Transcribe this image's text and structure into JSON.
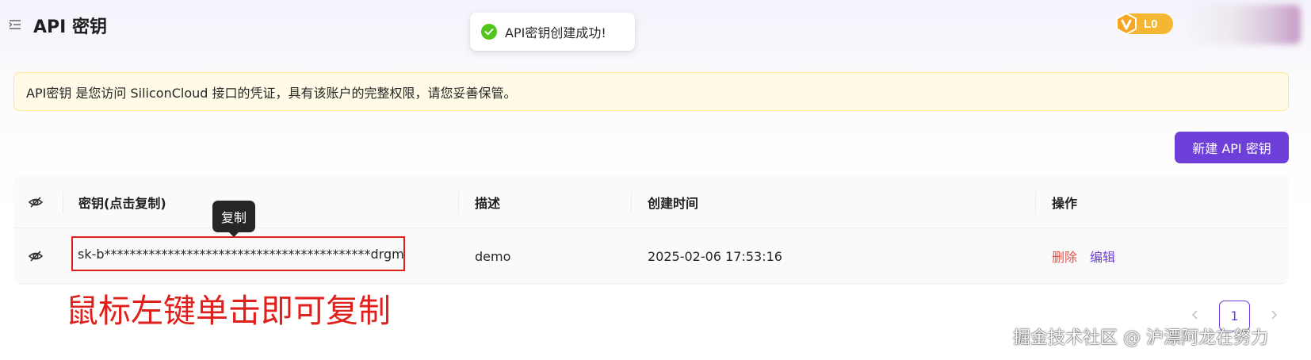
{
  "header": {
    "title": "API 密钥",
    "menu_icon": "menu-fold-icon",
    "level_badge": "L0",
    "level_icon": "v-badge-icon"
  },
  "toast": {
    "icon": "check-circle-icon",
    "message": "API密钥创建成功!",
    "color": "#52c41a"
  },
  "alert": {
    "text": "API密钥 是您访问 SiliconCloud 接口的凭证，具有该账户的完整权限，请您妥善保管。"
  },
  "actions": {
    "new_key_label": "新建 API 密钥"
  },
  "table": {
    "columns": [
      "密钥(点击复制)",
      "描述",
      "创建时间",
      "操作"
    ],
    "header_icon": "eye-invisible-icon",
    "rows": [
      {
        "key": "sk-b******************************************drgm",
        "description": "demo",
        "created_at": "2025-02-06 17:53:16",
        "actions": [
          "删除",
          "编辑"
        ]
      }
    ]
  },
  "tooltip": {
    "text": "复制"
  },
  "annotation": {
    "text": "鼠标左键单击即可复制",
    "color": "#e0201c"
  },
  "pagination": {
    "current_page": "1",
    "prev_icon": "chevron-left-icon",
    "next_icon": "chevron-right-icon"
  },
  "watermark": {
    "text": "掘金技术社区 @ 沪漂阿龙在努力"
  },
  "colors": {
    "primary": "#6e3fd9",
    "danger": "#e0524a",
    "alert_bg": "#fffbe6",
    "badge": "#f5b731"
  }
}
